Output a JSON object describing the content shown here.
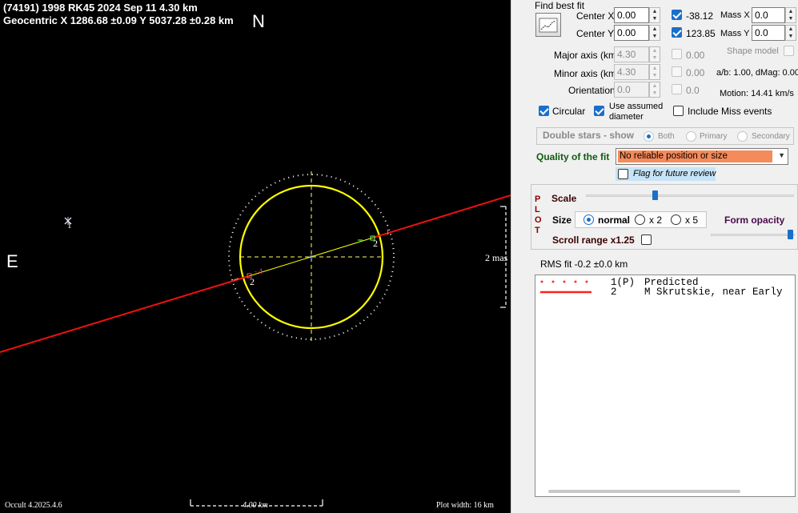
{
  "plot": {
    "title_line1": "(74191) 1998 RK45  2024 Sep 11   4.30 km",
    "title_line2": "Geocentric X  1286.68 ±0.09  Y 5037.28 ±0.28 km",
    "north_label": "N",
    "east_label": "E",
    "scale_bar_vertical": "2 mas",
    "scale_bar_horizontal": "4.00 km",
    "version": "Occult 4.2025.4.6",
    "plot_width": "Plot width: 16 km",
    "star_label": "1",
    "chord_label_a": "2",
    "chord_label_b": "2",
    "tick_a": "- 4",
    "tick_b": "1"
  },
  "panel": {
    "find_best_fit": "Find best fit",
    "center_x_label": "Center X",
    "center_x_value": "0.00",
    "center_x_result": "-38.12",
    "center_y_label": "Center Y",
    "center_y_value": "0.00",
    "center_y_result": "123.85",
    "mass_x_label": "Mass X",
    "mass_x_value": "0.0",
    "mass_y_label": "Mass Y",
    "mass_y_value": "0.0",
    "major_axis_label": "Major axis (km)",
    "major_axis_value": "4.30",
    "major_axis_result": "0.00",
    "minor_axis_label": "Minor axis (km)",
    "minor_axis_value": "4.30",
    "minor_axis_result": "0.00",
    "orientation_label": "Orientation",
    "orientation_value": "0.0",
    "orientation_result": "0.0",
    "shape_model": "Shape model",
    "ab_dmag": "a/b: 1.00, dMag: 0.00",
    "motion": "Motion: 14.41 km/s",
    "circular": "Circular",
    "use_assumed_1": "Use assumed",
    "use_assumed_2": "diameter",
    "include_miss": "Include Miss events",
    "double_stars": "Double stars - show",
    "both": "Both",
    "primary": "Primary",
    "secondary": "Secondary",
    "quality_label": "Quality of the fit",
    "quality_value": "No reliable position or size",
    "quality_color": "#f58a5a",
    "flag_review": "Flag for future review",
    "plot_letters": [
      "P",
      "L",
      "O",
      "T"
    ],
    "scale_label": "Scale",
    "scale_level": 0.33,
    "size_label": "Size",
    "size_normal": "normal",
    "size_x2": "x 2",
    "size_x5": "x 5",
    "form_opacity": "Form opacity",
    "opacity_level": 0.98,
    "scroll_range": "Scroll range x1.25",
    "rms_fit": "RMS fit -0.2 ±0.0 km"
  },
  "legend": {
    "rows": [
      {
        "num": "1(P)",
        "text": "Predicted",
        "style": "dotted"
      },
      {
        "num": "2",
        "text": "M Skrutskie, near Early",
        "style": "solid"
      }
    ],
    "predicted_color": "#ff3030",
    "observer_color": "#ff2020"
  }
}
